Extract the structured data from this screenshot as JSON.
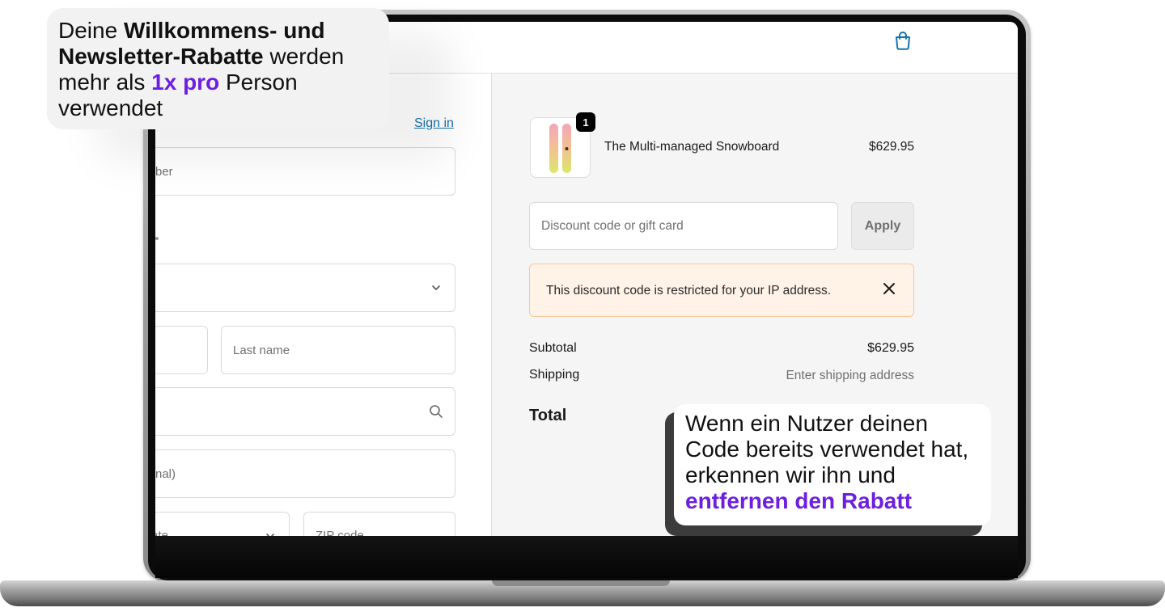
{
  "header": {
    "cart_icon": "shopping-bag-icon"
  },
  "contact": {
    "sign_in": "Sign in",
    "phone_placeholder_fragment": "ber"
  },
  "delivery": {
    "last_name_placeholder": "Last name",
    "apartment_placeholder_fragment": "nal)",
    "state_placeholder_fragment": "ate",
    "zip_placeholder": "ZIP code"
  },
  "summary": {
    "item": {
      "name": "The Multi-managed Snowboard",
      "price": "$629.95",
      "quantity": "1"
    },
    "discount_placeholder": "Discount code or gift card",
    "apply_label": "Apply",
    "alert_message": "This discount code is restricted for your IP address.",
    "subtotal_label": "Subtotal",
    "subtotal_value": "$629.95",
    "shipping_label": "Shipping",
    "shipping_value": "Enter shipping address",
    "total_label": "Total"
  },
  "callouts": {
    "top_left": {
      "t1": "Deine ",
      "b1": "Willkommens- und Newsletter-Rabatte",
      "t2": " werden mehr als ",
      "hl": "1x pro",
      "t3": " Person verwendet"
    },
    "bottom_right": {
      "t1": "Wenn ein Nutzer deinen Code bereits verwendet hat, erkennen wir ihn und ",
      "hl": "entfernen den Rabatt"
    }
  },
  "colors": {
    "accent_purple": "#6c1fe0",
    "link_blue": "#1773b0",
    "alert_bg": "#fff3e8"
  }
}
